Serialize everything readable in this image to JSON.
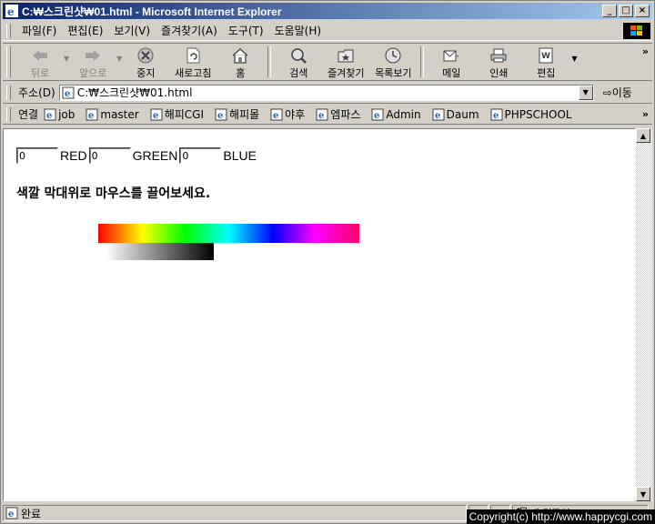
{
  "window": {
    "title": "C:₩스크린샷₩01.html - Microsoft Internet Explorer",
    "minimize": "_",
    "maximize": "□",
    "close": "×"
  },
  "menu": [
    "파일(F)",
    "편집(E)",
    "보기(V)",
    "즐겨찾기(A)",
    "도구(T)",
    "도움말(H)"
  ],
  "toolbar": {
    "back": "뒤로",
    "forward": "앞으로",
    "stop": "중지",
    "refresh": "새로고침",
    "home": "홈",
    "search": "검색",
    "favorites": "즐겨찾기",
    "history": "목록보기",
    "mail": "메일",
    "print": "인쇄",
    "edit": "편집",
    "more": "»"
  },
  "address": {
    "label": "주소(D)",
    "url": "C:₩스크린샷₩01.html",
    "go": "이동"
  },
  "links": {
    "label": "연결",
    "items": [
      "job",
      "master",
      "해피CGI",
      "해피몰",
      "야후",
      "엠파스",
      "Admin",
      "Daum",
      "PHPSCHOOL"
    ],
    "more": "»"
  },
  "page": {
    "red_value": "0",
    "red_label": "RED",
    "green_value": "0",
    "green_label": "GREEN",
    "blue_value": "0",
    "blue_label": "BLUE",
    "instruction": "색깔 막대위로 마우스를 끌어보세요."
  },
  "status": {
    "text": "완료",
    "zone": "내 컴퓨터"
  },
  "watermark": "Copyright(c) http://www.happycgi.com",
  "colors": {
    "titlebar_start": "#0a246a",
    "titlebar_end": "#a6caf0",
    "chrome": "#d4d0c8"
  }
}
